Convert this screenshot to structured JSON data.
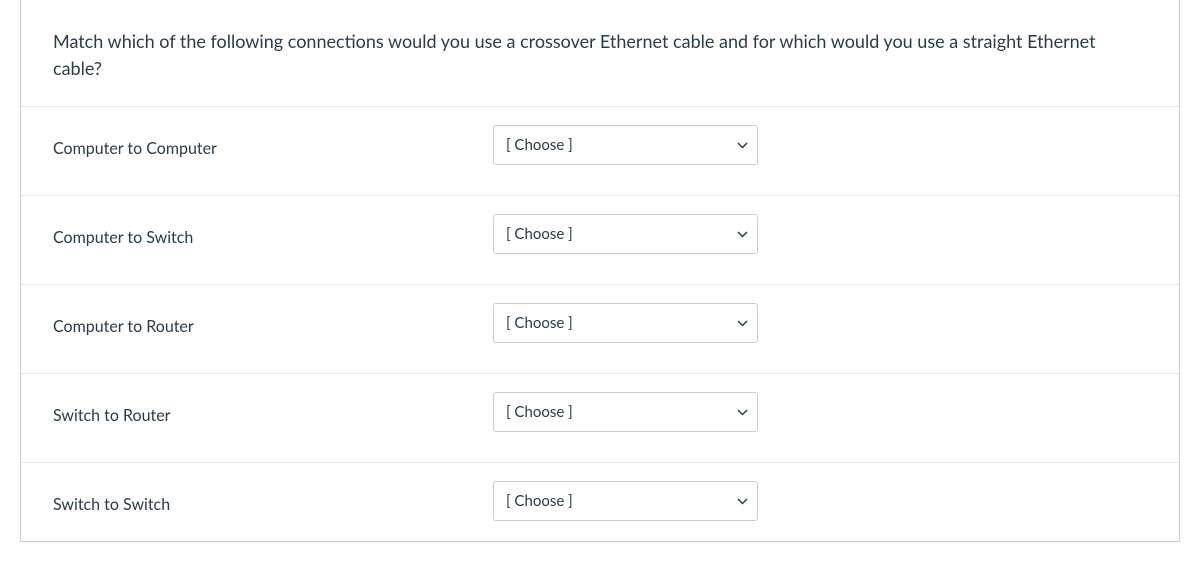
{
  "question": {
    "prompt": "Match which of the following connections would you use a crossover Ethernet cable and for which would you use a straight Ethernet cable?"
  },
  "choose_placeholder": "[ Choose ]",
  "rows": [
    {
      "label": "Computer to Computer"
    },
    {
      "label": "Computer to Switch"
    },
    {
      "label": "Computer to Router"
    },
    {
      "label": "Switch to Router"
    },
    {
      "label": "Switch to Switch"
    }
  ]
}
